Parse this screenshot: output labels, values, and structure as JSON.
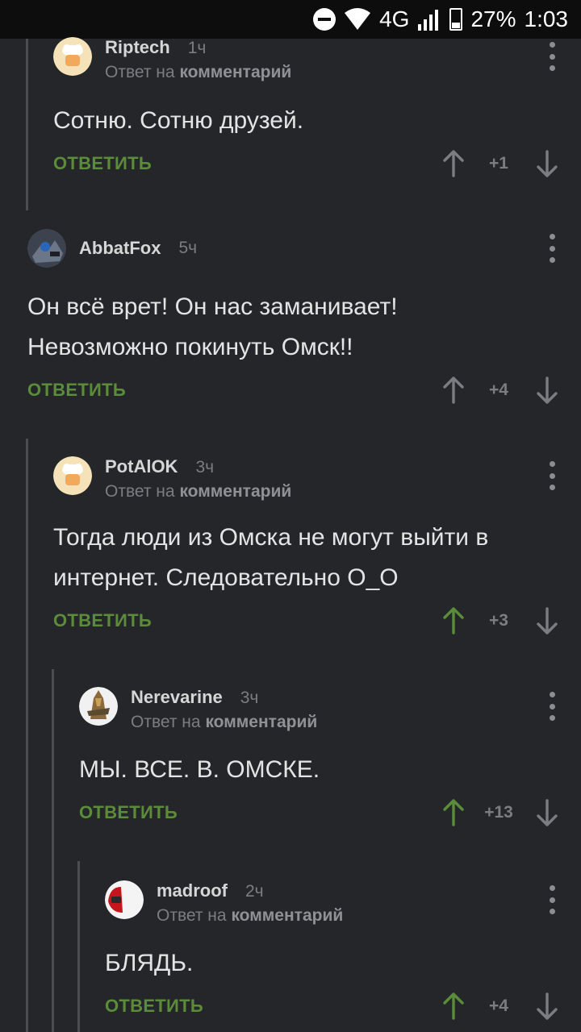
{
  "status_bar": {
    "network": "4G",
    "battery": "27%",
    "time": "1:03"
  },
  "reply_label": "ОТВЕТИТЬ",
  "reply_to_prefix": "Ответ на",
  "reply_to_target": "комментарий",
  "colors": {
    "background": "#24262a",
    "accent_green": "#5b8c3a",
    "vote_gray": "#7a7d82"
  },
  "comments": [
    {
      "username": "Riptech",
      "time": "1ч",
      "is_reply": true,
      "lines": [
        "Сотню. Сотню друзей."
      ],
      "rating": "+1",
      "upvoted": false,
      "avatar": "chef-avatar"
    },
    {
      "username": "AbbatFox",
      "time": "5ч",
      "is_reply": false,
      "lines": [
        "Он всё врет! Он нас заманивает!",
        "Невозможно покинуть Омск!!"
      ],
      "rating": "+4",
      "upvoted": false,
      "avatar": "robot-avatar"
    },
    {
      "username": "PotAlOK",
      "time": "3ч",
      "is_reply": true,
      "lines": [
        "Тогда люди из Омска не могут выйти в",
        "интернет. Следовательно О_О"
      ],
      "rating": "+3",
      "upvoted": true,
      "avatar": "chef-avatar"
    },
    {
      "username": "Nerevarine",
      "time": "3ч",
      "is_reply": true,
      "lines": [
        "МЫ. ВСЕ. В. ОМСКЕ."
      ],
      "rating": "+13",
      "upvoted": true,
      "avatar": "warrior-avatar"
    },
    {
      "username": "madroof",
      "time": "2ч",
      "is_reply": true,
      "lines": [
        "БЛЯДЬ."
      ],
      "rating": "+4",
      "upvoted": true,
      "avatar": "helmet-avatar"
    }
  ]
}
